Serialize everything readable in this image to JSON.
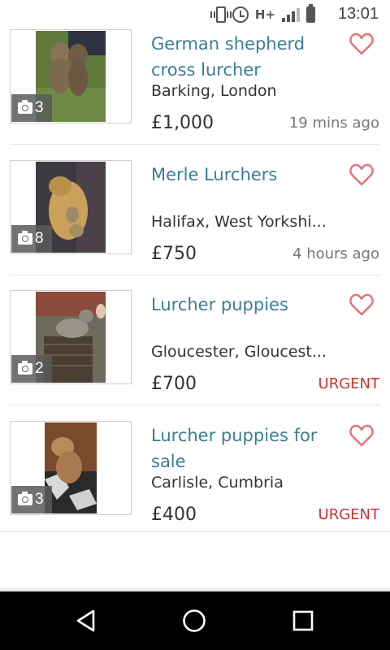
{
  "status_bar": {
    "network": "H+",
    "time": "13:01"
  },
  "listings": [
    {
      "title": "German shepherd cross lurcher",
      "location": "Barking, London",
      "price": "£1,000",
      "time": "19 mins ago",
      "urgent": "",
      "photo_count": "3"
    },
    {
      "title": "Merle Lurchers",
      "location": "Halifax, West Yorkshi...",
      "price": "£750",
      "time": "4 hours ago",
      "urgent": "",
      "photo_count": "8"
    },
    {
      "title": "Lurcher puppies",
      "location": "Gloucester, Gloucest...",
      "price": "£700",
      "time": "",
      "urgent": "URGENT",
      "photo_count": "2"
    },
    {
      "title": "Lurcher puppies for sale",
      "location": "Carlisle, Cumbria",
      "price": "£400",
      "time": "",
      "urgent": "URGENT",
      "photo_count": "3"
    }
  ],
  "colors": {
    "title": "#3a7d95",
    "heart": "#e8707a",
    "urgent": "#d32f2f"
  },
  "icons": {
    "favourite": "heart-icon",
    "photos": "camera-icon",
    "nav_back": "back-triangle-icon",
    "nav_home": "home-circle-icon",
    "nav_recents": "recents-square-icon"
  }
}
